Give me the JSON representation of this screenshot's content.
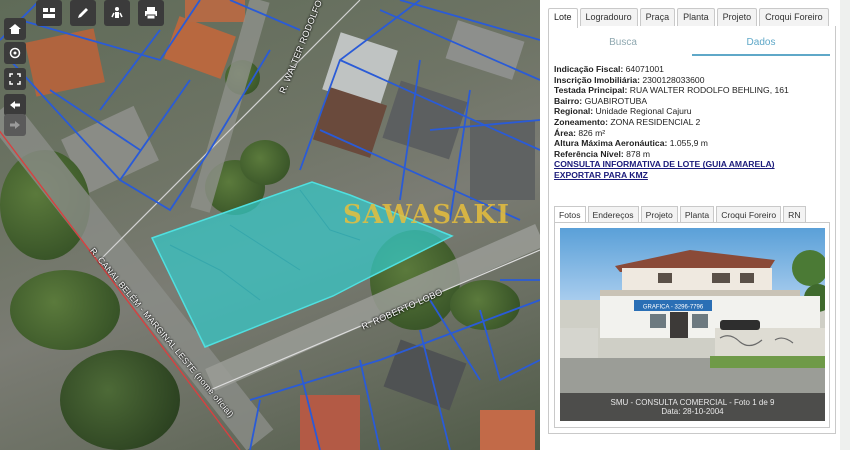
{
  "map": {
    "watermark": "SAWASAKI",
    "streets": {
      "walter": "R. WALTER RODOLFO BEHLING",
      "roberto": "R. ROBERTO LOBO",
      "marginal": "R. CANAL BELÉM - MARGINAL LESTE (nome oficial)"
    },
    "toolbar": [
      {
        "name": "layers-icon"
      },
      {
        "name": "edit-icon"
      },
      {
        "name": "street-view-icon"
      },
      {
        "name": "print-icon"
      }
    ],
    "side_buttons": [
      {
        "name": "home-icon"
      },
      {
        "name": "locate-icon"
      },
      {
        "name": "fullscreen-icon"
      },
      {
        "name": "back-arrow-icon"
      },
      {
        "name": "forward-arrow-icon"
      }
    ],
    "colors": {
      "parcel_outline": "#2a5bd7",
      "selected_lot": "#35c9c9",
      "road_edge": "#d84040"
    }
  },
  "panel": {
    "tabs": [
      "Lote",
      "Logradouro",
      "Praça",
      "Planta",
      "Projeto",
      "Croqui Foreiro"
    ],
    "active_tab": "Lote",
    "subtabs": [
      "Busca",
      "Dados"
    ],
    "active_subtab": "Dados",
    "fields": [
      {
        "label": "Indicação Fiscal:",
        "value": "64071001"
      },
      {
        "label": "Inscrição Imobiliária:",
        "value": "2300128033600"
      },
      {
        "label": "Testada Principal:",
        "value": "RUA WALTER RODOLFO BEHLING, 161"
      },
      {
        "label": "Bairro:",
        "value": "GUABIROTUBA"
      },
      {
        "label": "Regional:",
        "value": "Unidade Regional Cajuru"
      },
      {
        "label": "Zoneamento:",
        "value": "ZONA RESIDENCIAL 2"
      },
      {
        "label": "Área:",
        "value": "826 m²"
      },
      {
        "label": "Altura Máxima Aeronáutica:",
        "value": "1.055,9 m"
      },
      {
        "label": "Referência Nível:",
        "value": "878 m"
      }
    ],
    "links": {
      "consulta": "CONSULTA INFORMATIVA DE LOTE (GUIA AMARELA)",
      "exportar": "EXPORTAR PARA KMZ"
    },
    "inner_tabs": [
      "Fotos",
      "Endereços",
      "Projeto",
      "Planta",
      "Croqui Foreiro",
      "RN"
    ],
    "active_inner_tab": "Fotos",
    "photo": {
      "sign": "GRAFICA - 3296-7796",
      "caption_line1": "SMU - CONSULTA COMERCIAL - Foto 1 de 9",
      "caption_line2": "Data: 28-10-2004"
    }
  }
}
